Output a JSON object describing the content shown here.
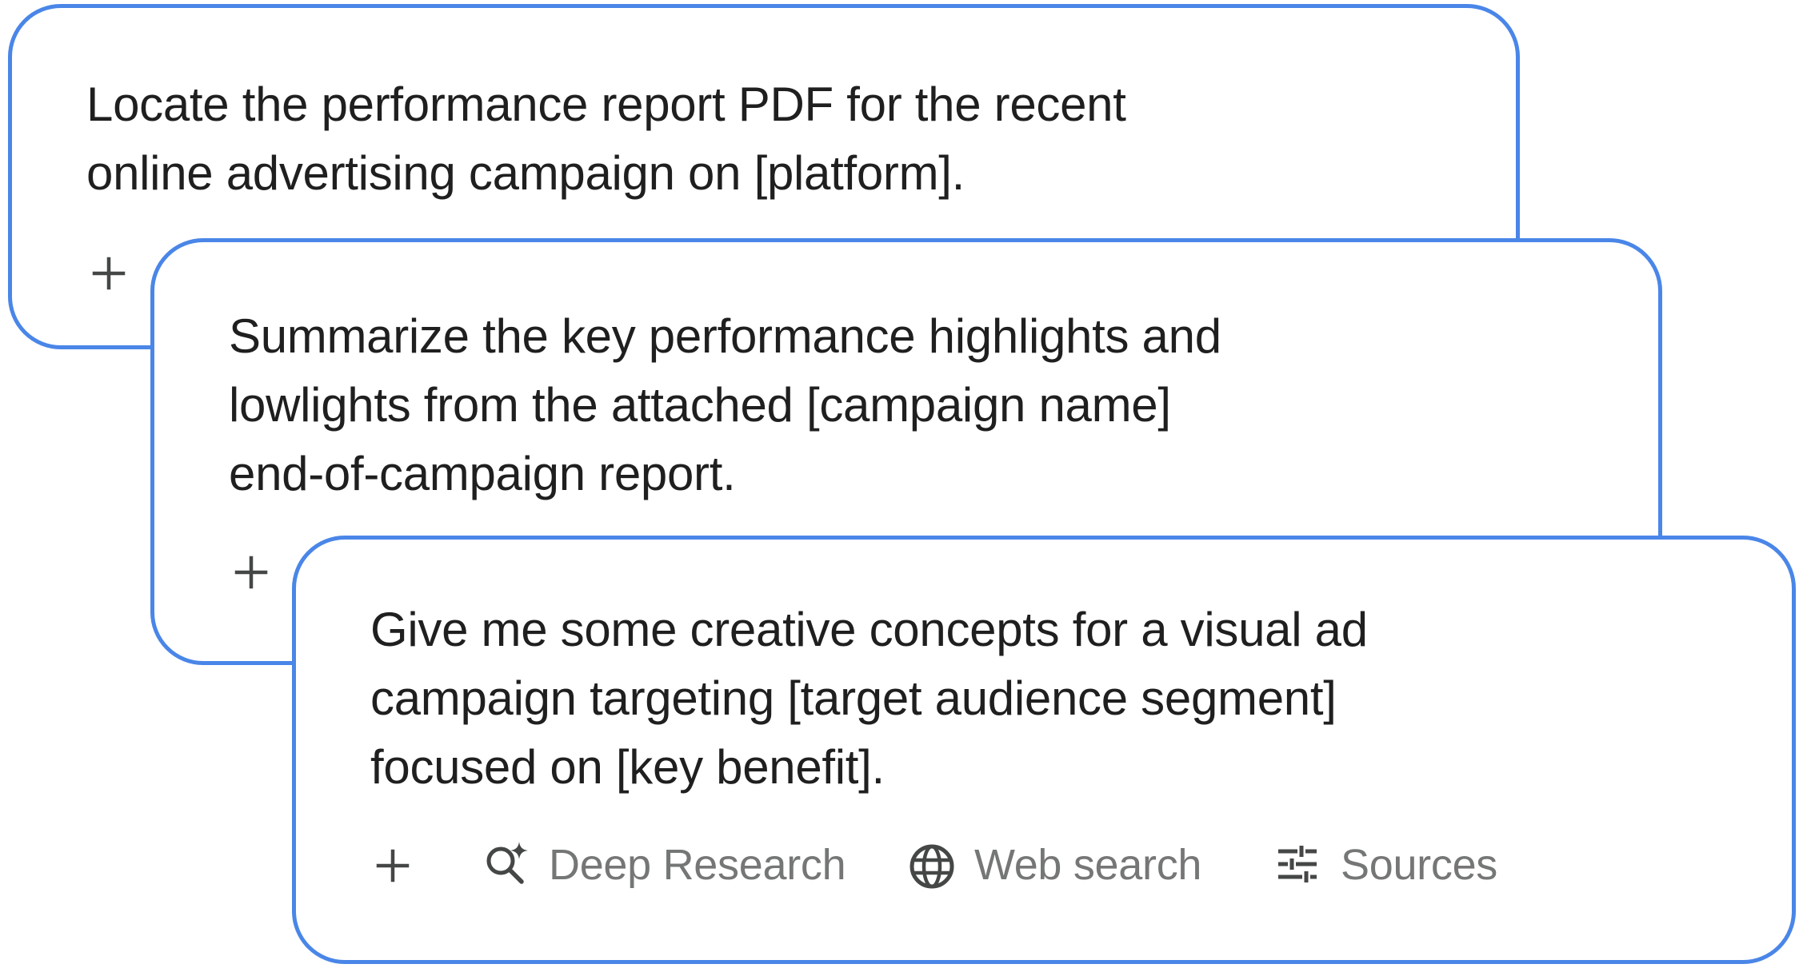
{
  "cards": [
    {
      "prompt_lines": [
        "Locate the performance report PDF for the recent",
        "online advertising campaign on [platform]."
      ],
      "add_icon": "plus-icon"
    },
    {
      "prompt_lines": [
        "Summarize the key performance highlights and",
        "lowlights from the attached [campaign name]",
        "end-of-campaign report."
      ],
      "add_icon": "plus-icon"
    },
    {
      "prompt_lines": [
        "Give me some creative concepts for a visual ad",
        "campaign targeting [target audience segment]",
        "focused on [key benefit]."
      ],
      "add_icon": "plus-icon",
      "tools": [
        {
          "label": "Deep Research",
          "icon": "deep-research-icon"
        },
        {
          "label": "Web search",
          "icon": "globe-icon"
        },
        {
          "label": "Sources",
          "icon": "tune-sliders-icon"
        }
      ]
    }
  ],
  "colors": {
    "card_border": "#4a86e8",
    "prompt_text": "#1f1f1f",
    "tool_text": "#747775",
    "icon": "#444746"
  }
}
